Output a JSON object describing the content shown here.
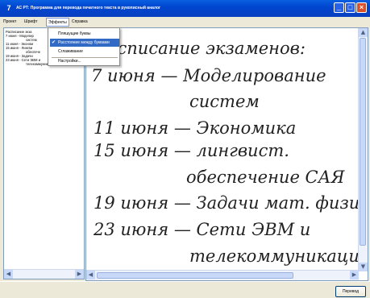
{
  "window": {
    "title": "АС РТ: Программа для перевода печатного текста в рукописный аналог",
    "app_icon": "7",
    "minimize_glyph": "_",
    "maximize_glyph": "□",
    "close_glyph": "×"
  },
  "menubar": {
    "items": [
      "Проект",
      "Шрифт",
      "Эффекты",
      "Справка"
    ],
    "active_index": 2
  },
  "effects_menu": {
    "items": [
      "Пляшущие буквы",
      "Расстояние между буквами",
      "Сглаживание",
      "Настройки..."
    ],
    "checked_index": 1,
    "check_glyph": "✔"
  },
  "source_text": {
    "lines": [
      "Расписание экза",
      "7 июня - Моделир",
      "систем",
      "11 июня - Эконом",
      "15 июня - Лингви",
      "обеспече",
      "19 июня - Задачи",
      "23 июня - Сети ЭВМ и",
      "телекоммуникации"
    ]
  },
  "handwritten_text": {
    "lines": [
      "асписание экзаменов:",
      "7 июня — Моделирование",
      "систем",
      "11 июня — Экономика",
      "15 июня — лингвист.",
      "обеспечение САЯ",
      "19 июня — Задачи мат. физи",
      "23 июня — Сети ЭВМ и",
      "телекоммуникаци"
    ]
  },
  "scroll_glyphs": {
    "up": "▲",
    "down": "▼",
    "left": "◀",
    "right": "▶"
  },
  "status": {
    "button_label": "Перевод"
  },
  "colors": {
    "accent": "#316ac5",
    "titlebar": "#0046d0",
    "ink": "#222222"
  }
}
